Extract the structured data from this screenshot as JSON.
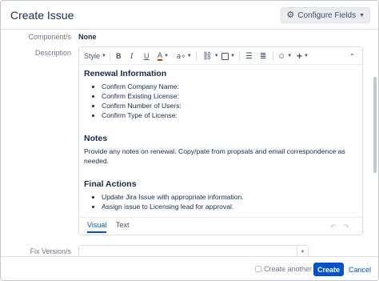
{
  "header": {
    "title": "Create Issue",
    "configure_fields_label": "Configure Fields",
    "configure_icon": "gear-icon"
  },
  "form": {
    "components_label": "Component/s",
    "components_value": "None",
    "description_label": "Description",
    "fix_version_label": "Fix Version/s",
    "fix_version_value": ""
  },
  "toolbar": {
    "style_label": "Style",
    "bold": "B",
    "italic": "I",
    "underline": "U",
    "text_color": "A",
    "more_format": "a",
    "icons": [
      "chevron-down-icon",
      "link-icon",
      "attachment-icon",
      "bullet-list-icon",
      "numbered-list-icon",
      "emoji-icon",
      "plus-icon",
      "collapse-icon"
    ]
  },
  "description": {
    "h1": "Renewal Information",
    "list1": [
      "Confirm Company Name:",
      "Confirm Existing License:",
      "Confirm Number of Users:",
      "Confirm Type of License:"
    ],
    "h2": "Notes",
    "notes_text": "Provide any notes on renewal. Copy/pate from propsals and email correspondence as needed.",
    "h3": "Final Actions",
    "list3": [
      "Update Jira Issue with appropriate information.",
      "Assign issue to Licensing lead for approval."
    ]
  },
  "editor_tabs": {
    "visual": "Visual",
    "text": "Text",
    "active": "Visual"
  },
  "footer": {
    "create_another_label": "Create another",
    "create_another_checked": false,
    "create_label": "Create",
    "cancel_label": "Cancel"
  },
  "colors": {
    "primary": "#0052cc",
    "text": "#172b4d",
    "muted": "#6b778c",
    "border": "#dfe1e6"
  }
}
